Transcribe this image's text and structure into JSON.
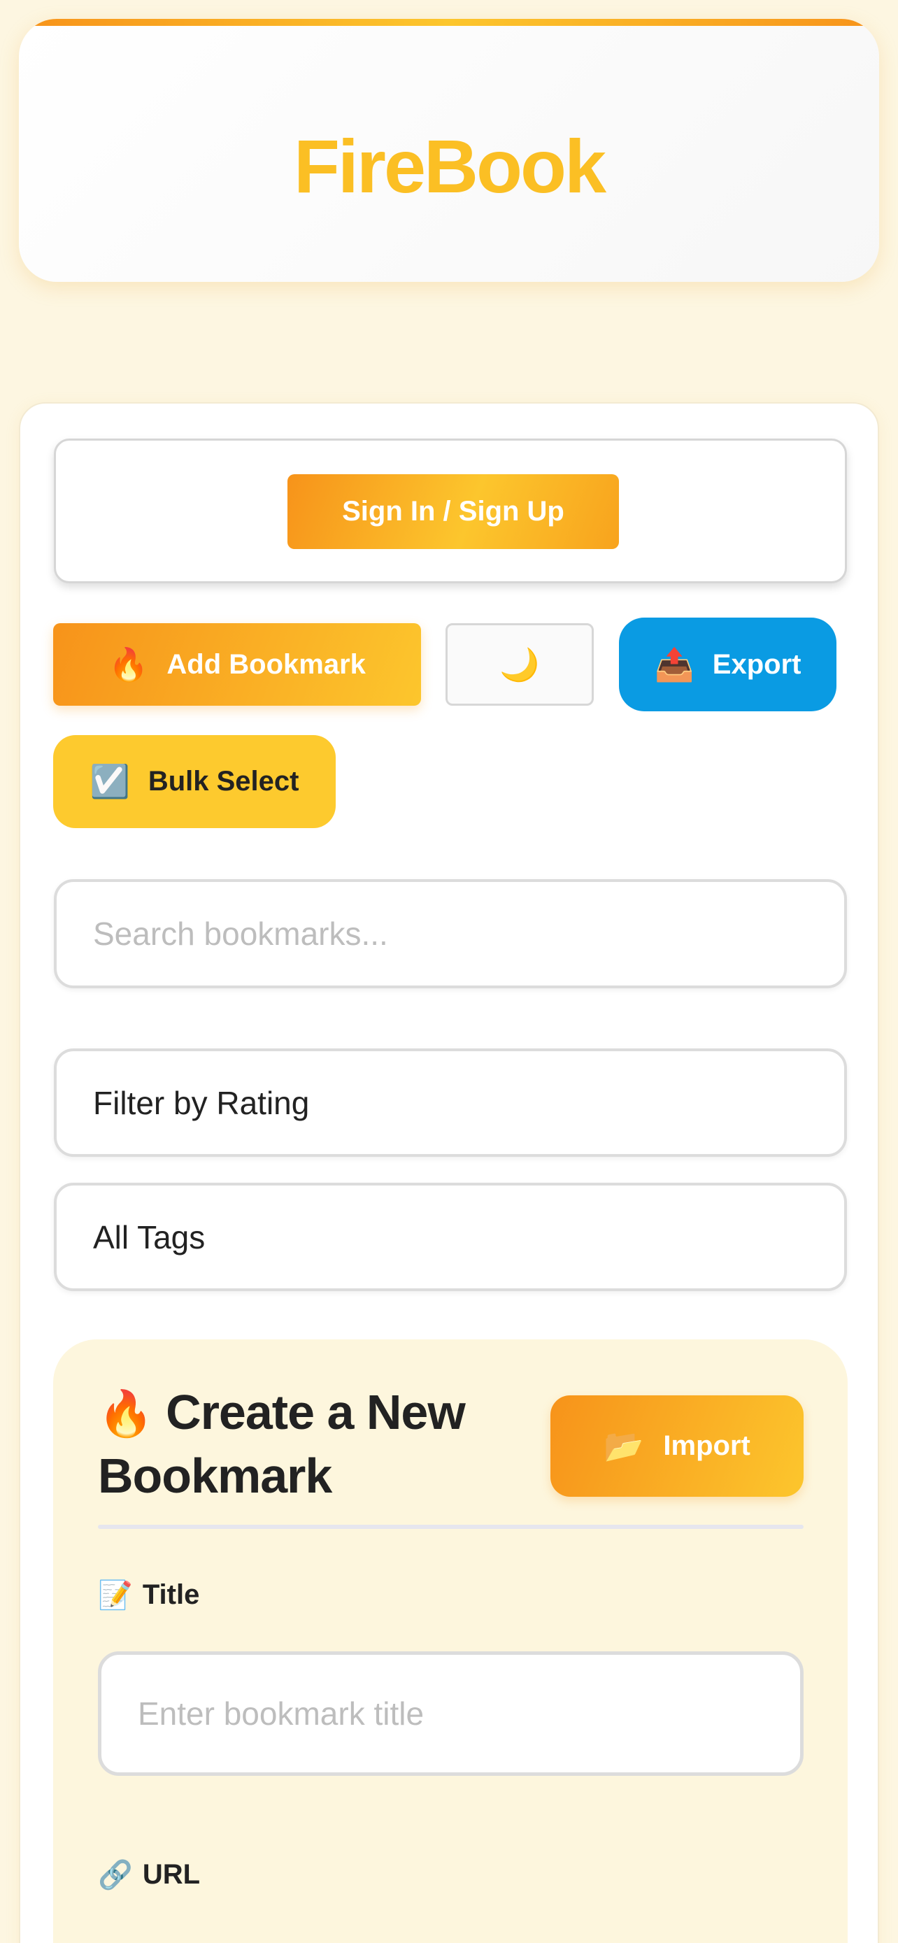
{
  "brand": {
    "title": "FireBook"
  },
  "auth": {
    "signin_label": "Sign In / Sign Up"
  },
  "toolbar": {
    "add_icon": "🔥",
    "add_label": "Add Bookmark",
    "theme_icon": "🌙",
    "export_icon": "📤",
    "export_label": "Export",
    "bulk_icon": "☑️",
    "bulk_label": "Bulk Select"
  },
  "search": {
    "placeholder": "Search bookmarks..."
  },
  "filters": {
    "rating_selected": "Filter by Rating",
    "tags_selected": "All Tags"
  },
  "create": {
    "title_icon": "🔥",
    "title_line1": "Create a New",
    "title_line2": "Bookmark",
    "import_icon": "📂",
    "import_label": "Import",
    "title_field_icon": "📝",
    "title_field_label": "Title",
    "title_placeholder": "Enter bookmark title",
    "url_field_icon": "🔗",
    "url_field_label": "URL"
  },
  "colors": {
    "accent_orange": "#f7931a",
    "accent_yellow": "#fcc62d",
    "export_blue": "#0a9be3",
    "page_bg": "#fdf6e1"
  }
}
